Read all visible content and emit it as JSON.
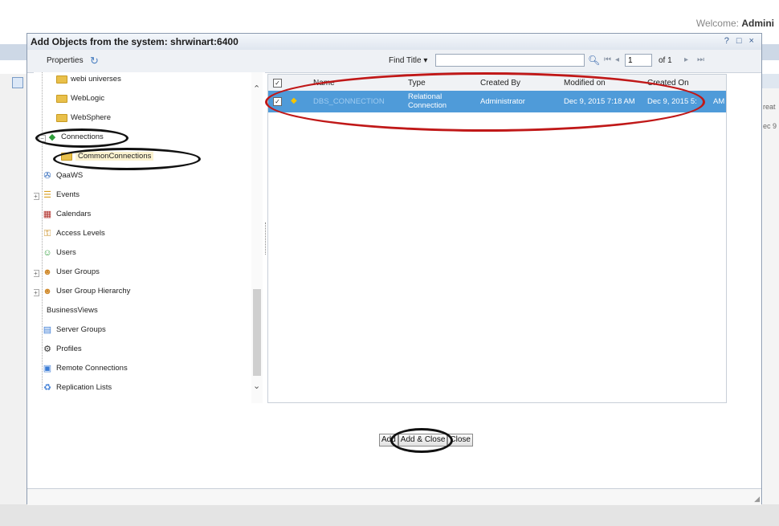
{
  "background": {
    "welcome_prefix": "Welcome: ",
    "welcome_user": "Admini",
    "right_snippet_1": "reat",
    "right_snippet_2": "ec 9"
  },
  "dialog": {
    "title": "Add Objects from the system: shrwinart:6400",
    "controls": "? □ ×",
    "toolbar": {
      "properties_label": "Properties",
      "find_label": "Find Title ▾",
      "find_value": "",
      "page_value": "1",
      "page_of": "of 1"
    },
    "tree": {
      "items": [
        {
          "label": "webi universes"
        },
        {
          "label": "WebLogic"
        },
        {
          "label": "WebSphere"
        },
        {
          "label": "Connections"
        },
        {
          "label": "CommonConnections"
        },
        {
          "label": "QaaWS"
        },
        {
          "label": "Events"
        },
        {
          "label": "Calendars"
        },
        {
          "label": "Access Levels"
        },
        {
          "label": "Users"
        },
        {
          "label": "User Groups"
        },
        {
          "label": "User Group Hierarchy"
        },
        {
          "label": "BusinessViews"
        },
        {
          "label": "Server Groups"
        },
        {
          "label": "Profiles"
        },
        {
          "label": "Remote Connections"
        },
        {
          "label": "Replication Lists"
        }
      ]
    },
    "list": {
      "columns": [
        "Name",
        "Type",
        "Created By",
        "Modified on",
        "Created On"
      ],
      "rows": [
        {
          "name": "DBS_CONNECTION",
          "type_line1": "Relational",
          "type_line2": "Connection",
          "created_by": "Administrator",
          "modified_on": "Dec 9, 2015 7:18 AM",
          "created_on": "Dec 9, 2015 5:",
          "created_on_tail": "AM",
          "checked": true
        }
      ]
    },
    "buttons": {
      "add": "Add",
      "add_close": "Add & Close",
      "close": "Close"
    }
  },
  "colors": {
    "selection": "#4f9bd9",
    "annotation_black": "#111111",
    "annotation_red": "#c01818"
  }
}
